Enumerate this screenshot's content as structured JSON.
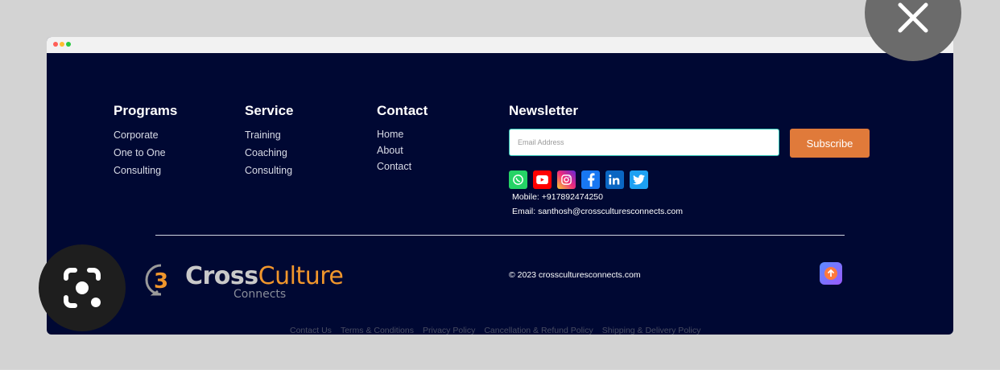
{
  "footer": {
    "programs": {
      "heading": "Programs",
      "links": [
        "Corporate",
        "One to One",
        "Consulting"
      ]
    },
    "service": {
      "heading": "Service",
      "links": [
        "Training",
        "Coaching",
        "Consulting"
      ]
    },
    "contact": {
      "heading": "Contact",
      "links": [
        "Home",
        "About",
        "Contact"
      ]
    },
    "newsletter": {
      "heading": "Newsletter",
      "email_placeholder": "Email Address",
      "subscribe_label": "Subscribe",
      "mobile": "Mobile: +917892474250",
      "email": "Email: santhosh@crossculturesconnects.com"
    },
    "socials": [
      "whatsapp-icon",
      "youtube-icon",
      "instagram-icon",
      "facebook-icon",
      "linkedin-icon",
      "twitter-icon"
    ],
    "logo": {
      "part1": "Cross",
      "part2": "Culture",
      "sub": "Connects",
      "mark": "3"
    },
    "copyright": "© 2023 crossculturesconnects.com",
    "bottom_links": [
      "Contact Us",
      "Terms & Conditions",
      "Privacy Policy",
      "Cancellation & Refund Policy",
      "Shipping & Delivery Policy"
    ]
  },
  "colors": {
    "footer_bg": "#000833",
    "accent_orange": "#e07a3a",
    "input_border": "#2ec4b6"
  }
}
